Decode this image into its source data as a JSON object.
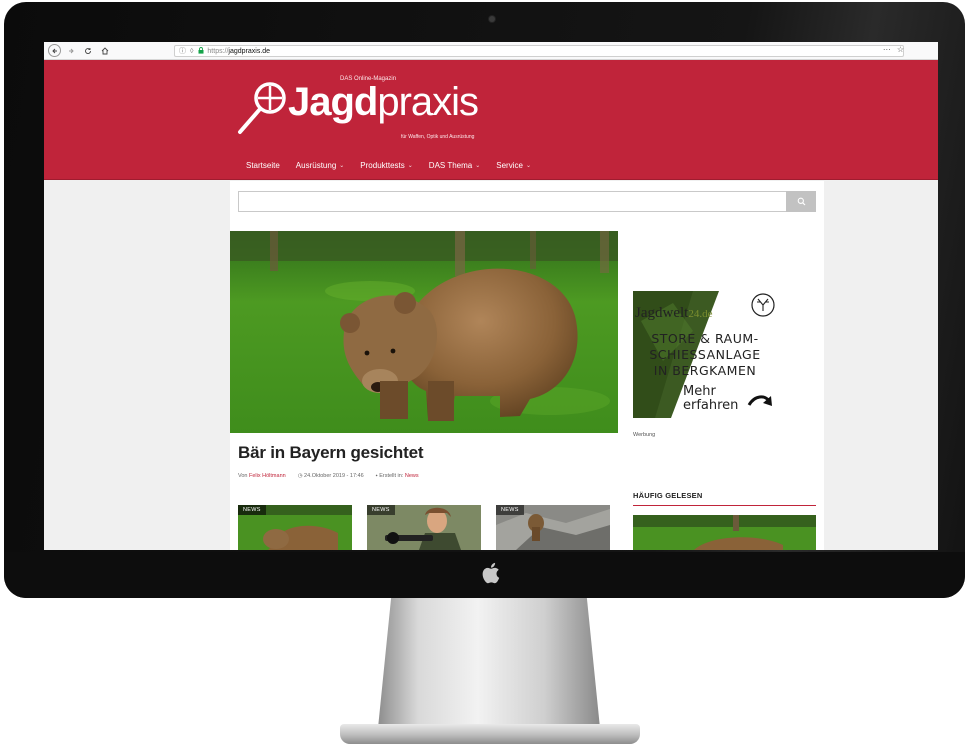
{
  "browser": {
    "url_prefix": "https://",
    "url_host": "jagdpraxis.de",
    "menu_glyph": "···",
    "bookmark_glyph": "☆"
  },
  "site": {
    "logo_bold": "Jagd",
    "logo_light": "praxis",
    "tagline": "DAS Online-Magazin",
    "subline": "für Waffen, Optik und Ausrüstung",
    "brand_color": "#c0243a"
  },
  "nav": {
    "items": [
      {
        "label": "Startseite",
        "has_dropdown": false
      },
      {
        "label": "Ausrüstung",
        "has_dropdown": true
      },
      {
        "label": "Produkttests",
        "has_dropdown": true
      },
      {
        "label": "DAS Thema",
        "has_dropdown": true
      },
      {
        "label": "Service",
        "has_dropdown": true
      }
    ]
  },
  "search": {
    "value": "",
    "icon": "search-icon"
  },
  "featured": {
    "title": "Bär in Bayern gesichtet",
    "author_prefix": "Von",
    "author": "Felix Höltmann",
    "date": "24.Oktober 2019 - 17:46",
    "category_prefix": "Erstellt in:",
    "category": "News"
  },
  "thumbnails": [
    {
      "tag": "NEWS"
    },
    {
      "tag": "NEWS"
    },
    {
      "tag": "NEWS"
    }
  ],
  "ad": {
    "brand": "Jagdwelt",
    "brand_tld": "24.de",
    "line1": "STORE & RAUM-",
    "line2": "SCHIESSANLAGE",
    "line3": "IN BERGKAMEN",
    "more_line1": "Mehr",
    "more_line2": "erfahren",
    "label": "Werbung"
  },
  "sidebar": {
    "popular_title": "HÄUFIG GELESEN"
  }
}
